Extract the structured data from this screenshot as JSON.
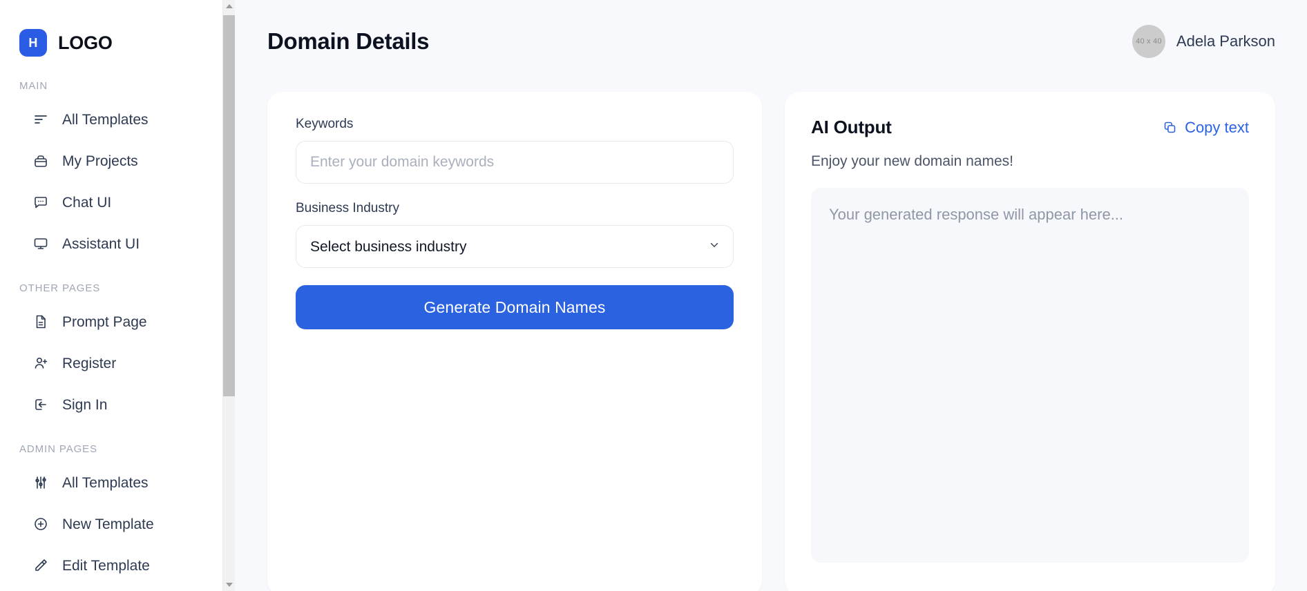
{
  "brand": {
    "mark_letter": "H",
    "name": "LOGO"
  },
  "sidebar": {
    "sections": [
      {
        "label": "MAIN",
        "items": [
          {
            "label": "All Templates",
            "icon": "list-lines-icon"
          },
          {
            "label": "My Projects",
            "icon": "briefcase-icon"
          },
          {
            "label": "Chat UI",
            "icon": "chat-bubble-icon"
          },
          {
            "label": "Assistant UI",
            "icon": "monitor-icon"
          }
        ]
      },
      {
        "label": "OTHER PAGES",
        "items": [
          {
            "label": "Prompt Page",
            "icon": "document-icon"
          },
          {
            "label": "Register",
            "icon": "user-plus-icon"
          },
          {
            "label": "Sign In",
            "icon": "sign-in-icon"
          }
        ]
      },
      {
        "label": "ADMIN PAGES",
        "items": [
          {
            "label": "All Templates",
            "icon": "sliders-icon"
          },
          {
            "label": "New Template",
            "icon": "plus-circle-icon"
          },
          {
            "label": "Edit Template",
            "icon": "edit-icon"
          }
        ]
      }
    ],
    "scrollbar": {
      "up_arrow": "scroll-up-arrow-icon",
      "down_arrow": "scroll-down-arrow-icon"
    }
  },
  "header": {
    "title": "Domain Details",
    "user": {
      "name": "Adela Parkson",
      "avatar_text": "40 x 40"
    }
  },
  "form": {
    "keywords": {
      "label": "Keywords",
      "value": "",
      "placeholder": "Enter your domain keywords"
    },
    "industry": {
      "label": "Business Industry",
      "selected": "Select business industry",
      "options": [
        "Select business industry"
      ],
      "caret_icon": "chevron-down-icon"
    },
    "submit_label": "Generate Domain Names"
  },
  "output": {
    "title": "AI Output",
    "copy_label": "Copy text",
    "copy_icon": "copy-icon",
    "subtitle": "Enjoy your new domain names!",
    "placeholder": "Your generated response will appear here..."
  },
  "colors": {
    "accent": "#2b62e0",
    "brand_mark": "#2b5ce6",
    "page_bg": "#f8f9fc",
    "card_bg": "#ffffff",
    "output_box_bg": "#f7f8fb",
    "muted_text": "#a0a7b4"
  }
}
